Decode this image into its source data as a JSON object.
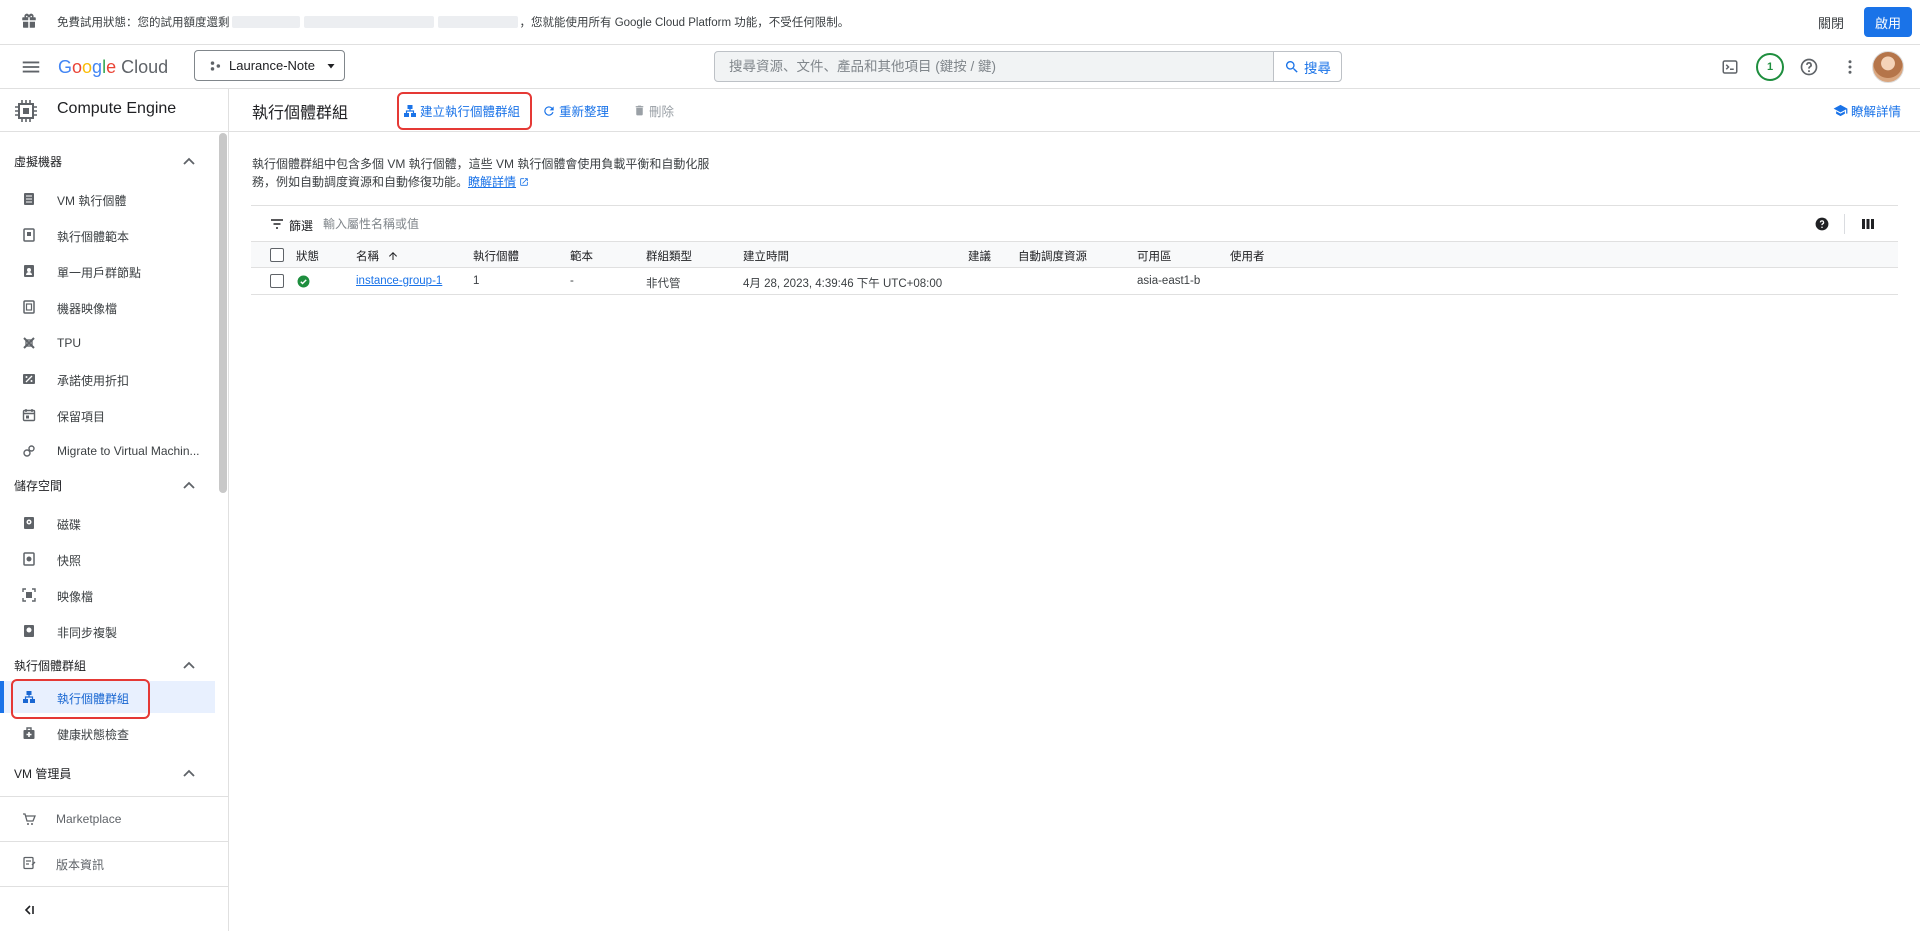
{
  "banner": {
    "message_start": "免費試用狀態：您的試用額度還剩",
    "message_end": "，您就能使用所有 Google Cloud Platform 功能，不受任何限制。",
    "close_label": "關閉",
    "activate_label": "啟用"
  },
  "topbar": {
    "logo_letters": [
      "G",
      "o",
      "o",
      "g",
      "l",
      "e"
    ],
    "logo_product": "Cloud",
    "project_name": "Laurance-Note",
    "search_placeholder": "搜尋資源、文件、產品和其他項目 (鍵按 / 鍵)",
    "search_button": "搜尋",
    "notification_count": "1"
  },
  "sidebar": {
    "product_title": "Compute Engine",
    "sections": [
      {
        "title": "虛擬機器",
        "items": [
          "VM 執行個體",
          "執行個體範本",
          "單一用戶群節點",
          "機器映像檔",
          "TPU",
          "承諾使用折扣",
          "保留項目",
          "Migrate to Virtual Machin..."
        ]
      },
      {
        "title": "儲存空間",
        "items": [
          "磁碟",
          "快照",
          "映像檔",
          "非同步複製"
        ]
      },
      {
        "title": "執行個體群組",
        "items": [
          "執行個體群組",
          "健康狀態檢查"
        ]
      },
      {
        "title": "VM 管理員",
        "items": []
      }
    ],
    "footer": {
      "marketplace": "Marketplace",
      "release_notes": "版本資訊"
    }
  },
  "main": {
    "page_title": "執行個體群組",
    "actions": {
      "create": "建立執行個體群組",
      "refresh": "重新整理",
      "delete": "刪除",
      "learn": "瞭解詳情"
    },
    "description": {
      "line1": "執行個體群組中包含多個 VM 執行個體，這些 VM 執行個體會使用負載平衡和自動化服",
      "line2": "務，例如自動調度資源和自動修復功能。",
      "link": "瞭解詳情"
    },
    "filter": {
      "label": "篩選",
      "placeholder": "輸入屬性名稱或值"
    },
    "table": {
      "columns": [
        "狀態",
        "名稱",
        "執行個體",
        "範本",
        "群組類型",
        "建立時間",
        "建議",
        "自動調度資源",
        "可用區",
        "使用者"
      ],
      "rows": [
        {
          "status": "ok",
          "name": "instance-group-1",
          "instances": "1",
          "template": "-",
          "group_type": "非代管",
          "created": "4月 28, 2023, 4:39:46 下午 UTC+08:00",
          "recommendation": "",
          "autoscaling": "",
          "zone": "asia-east1-b",
          "in_use_by": ""
        }
      ]
    }
  },
  "colors": {
    "primary": "#1a73e8",
    "highlight": "#e53935",
    "status_ok": "#1e8e3e"
  }
}
